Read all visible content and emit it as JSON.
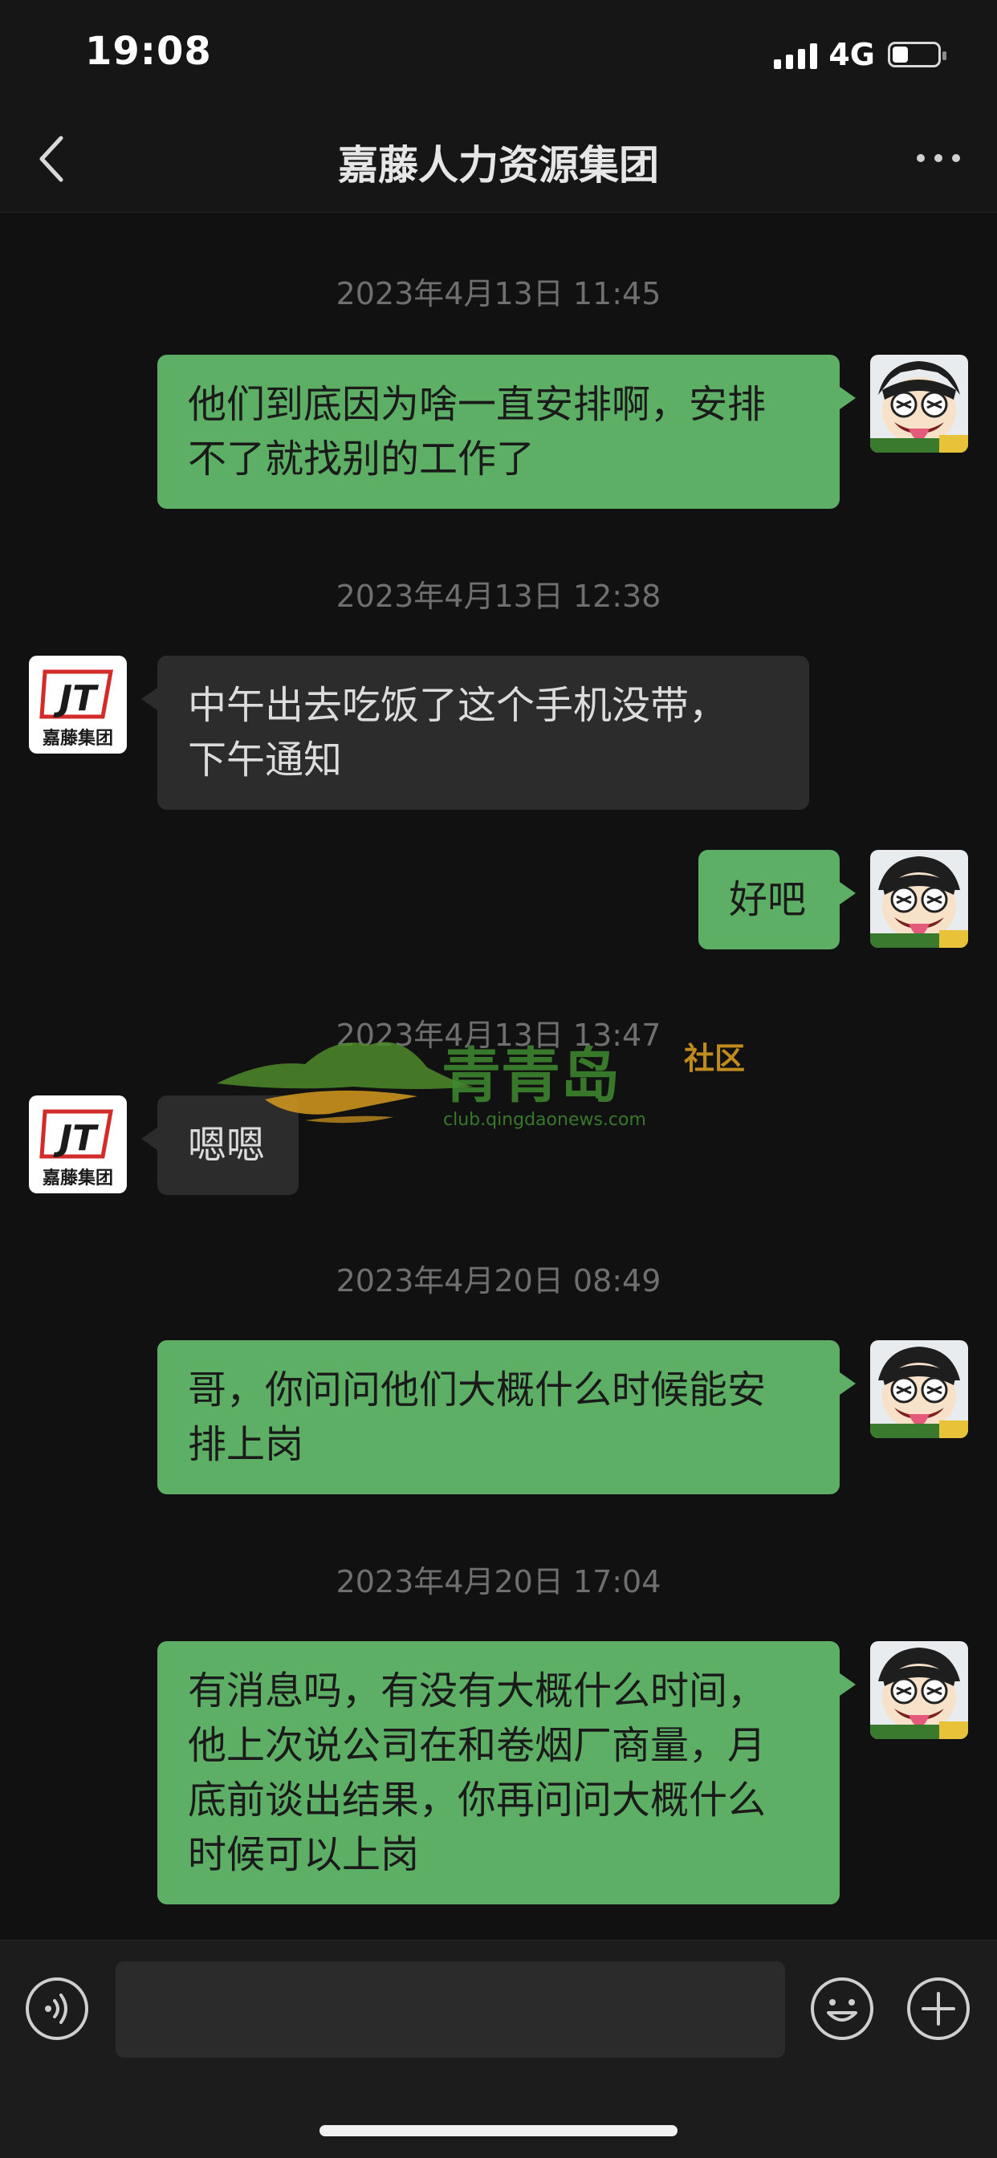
{
  "status_bar": {
    "time": "19:08",
    "network": "4G",
    "battery_level": 0.35
  },
  "header": {
    "title": "嘉藤人力资源集团",
    "back_icon": "chevron-left-icon",
    "more_icon": "more-dots-icon"
  },
  "contact": {
    "logo_text": "嘉藤集团",
    "logo_mark": "JT"
  },
  "messages": [
    {
      "type": "timestamp",
      "text": "2023年4月13日 11:45"
    },
    {
      "type": "sent",
      "lines": [
        "他们到底因为啥一直安排啊，安排",
        "不了就找别的工作了"
      ]
    },
    {
      "type": "timestamp",
      "text": "2023年4月13日 12:38"
    },
    {
      "type": "received",
      "lines": [
        "中午出去吃饭了这个手机没带，",
        "下午通知"
      ]
    },
    {
      "type": "sent",
      "lines": [
        "好吧"
      ]
    },
    {
      "type": "timestamp",
      "text": "2023年4月13日 13:47"
    },
    {
      "type": "received",
      "lines": [
        "嗯嗯"
      ]
    },
    {
      "type": "timestamp",
      "text": "2023年4月20日 08:49"
    },
    {
      "type": "sent",
      "lines": [
        "哥，你问问他们大概什么时候能安",
        "排上岗"
      ]
    },
    {
      "type": "timestamp",
      "text": "2023年4月20日 17:04"
    },
    {
      "type": "sent",
      "lines": [
        "有消息吗，有没有大概什么时间，",
        "他上次说公司在和卷烟厂商量，月",
        "底前谈出结果，你再问问大概什么",
        "时候可以上岗"
      ]
    }
  ],
  "watermark": {
    "name": "青青岛",
    "suffix": "社区",
    "url": "club.qingdaonews.com"
  },
  "input_bar": {
    "voice_icon": "voice-icon",
    "emoji_icon": "emoji-icon",
    "plus_icon": "plus-icon",
    "input_value": ""
  }
}
